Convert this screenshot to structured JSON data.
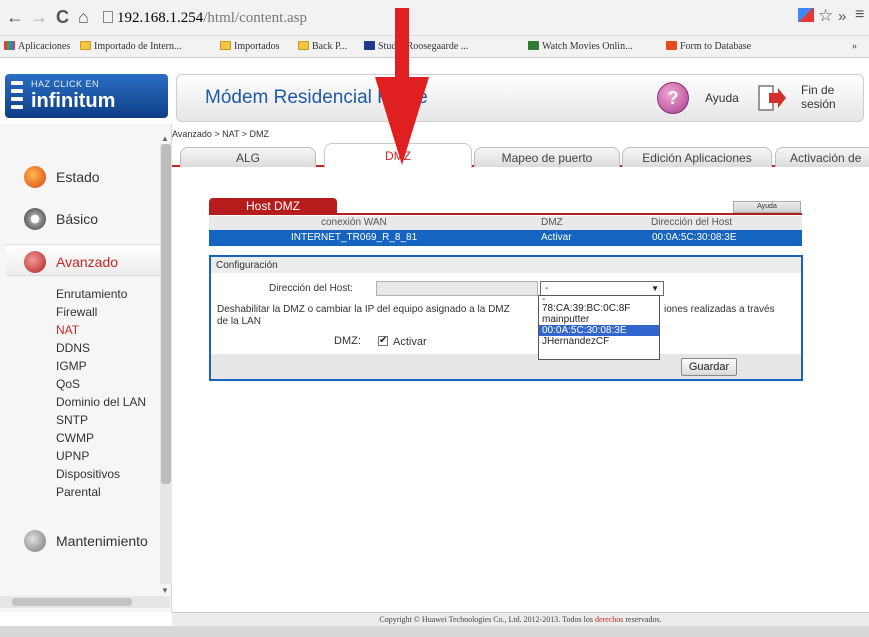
{
  "browser": {
    "back": "←",
    "forward": "→",
    "reload": "C",
    "home": "⌂",
    "url_host": "192.168.1.254",
    "url_path": "/html/content.asp",
    "star": "☆",
    "more": "»",
    "menu": "≡"
  },
  "bookmarks": [
    {
      "label": "Aplicaciones",
      "icon": "apps-grid-icon"
    },
    {
      "label": "Importado de Intern...",
      "icon": "folder-icon"
    },
    {
      "label": "Importados",
      "icon": "folder-icon"
    },
    {
      "label": "Back P...",
      "icon": "folder-icon"
    },
    {
      "label": "Studio Roosegaarde ...",
      "icon": "site-icon"
    },
    {
      "label": "Watch Movies Onlin...",
      "icon": "site-icon"
    },
    {
      "label": "Form to Database",
      "icon": "site-icon"
    },
    {
      "label": "»",
      "icon": ""
    }
  ],
  "logo": {
    "line1": "HAZ CLICK EN",
    "line2": "infinitum"
  },
  "header": {
    "title": "Módem Residencial H   32e",
    "help": "Ayuda",
    "help_icon": "?",
    "logout_line1": "Fin de",
    "logout_line2": "sesión"
  },
  "breadcrumb": "Avanzado > NAT > DMZ",
  "tabs": [
    {
      "label": "ALG",
      "active": false
    },
    {
      "label": "DMZ",
      "active": true
    },
    {
      "label": "Mapeo de puerto",
      "active": false
    },
    {
      "label": "Edición Aplicaciones",
      "active": false
    },
    {
      "label": "Activación de",
      "active": false
    }
  ],
  "sidebar": {
    "sections": [
      {
        "label": "Estado",
        "icon": "status-icon",
        "color": "#d84315"
      },
      {
        "label": "Básico",
        "icon": "gear-icon",
        "color": "#8d8d8d"
      },
      {
        "label": "Avanzado",
        "icon": "tools-icon",
        "color": "#c62828"
      },
      {
        "label": "Mantenimiento",
        "icon": "maintenance-icon",
        "color": "#8d8d8d"
      }
    ],
    "subitems": [
      "Enrutamiento",
      "Firewall",
      "NAT",
      "DDNS",
      "IGMP",
      "QoS",
      "Dominio del LAN",
      "SNTP",
      "CWMP",
      "UPNP",
      "Dispositivos",
      "Parental"
    ],
    "active_subitem": "NAT"
  },
  "dmz": {
    "section_title": "Host DMZ",
    "help_button": "Ayuda",
    "table_headers": [
      "conexión WAN",
      "DMZ",
      "Dirección del Host"
    ],
    "table_row": [
      "INTERNET_TR069_R_8_81",
      "Activar",
      "00:0A:5C:30:08:3E"
    ],
    "config_title": "Configuración",
    "host_label": "Dirección del Host:",
    "host_value": "",
    "select_value": "-",
    "note_line1": "Deshabilitar la DMZ o cambiar la IP del equipo asignado a la DMZ",
    "note_line1_tail": "iones realizadas a través",
    "note_line2": "de la LAN",
    "dmz_label": "DMZ:",
    "checkbox_mark": "✔",
    "checkbox_label": "Activar",
    "save_button": "Guardar",
    "dropdown_options": [
      "-",
      "78:CA:39:BC:0C:8F",
      "mainputter",
      "00:0A:5C:30:08:3E",
      "JHernandezCF"
    ],
    "dropdown_selected_index": 3
  },
  "footer": {
    "text_before": "Copyright © Huawei Technologies Co., Ltd. 2012-2013. Todos los ",
    "link": "derechos",
    "text_after": " reservados."
  },
  "colors": {
    "brand_red": "#c62828",
    "brand_blue": "#1565c0",
    "annotation_arrow": "#e02020"
  }
}
